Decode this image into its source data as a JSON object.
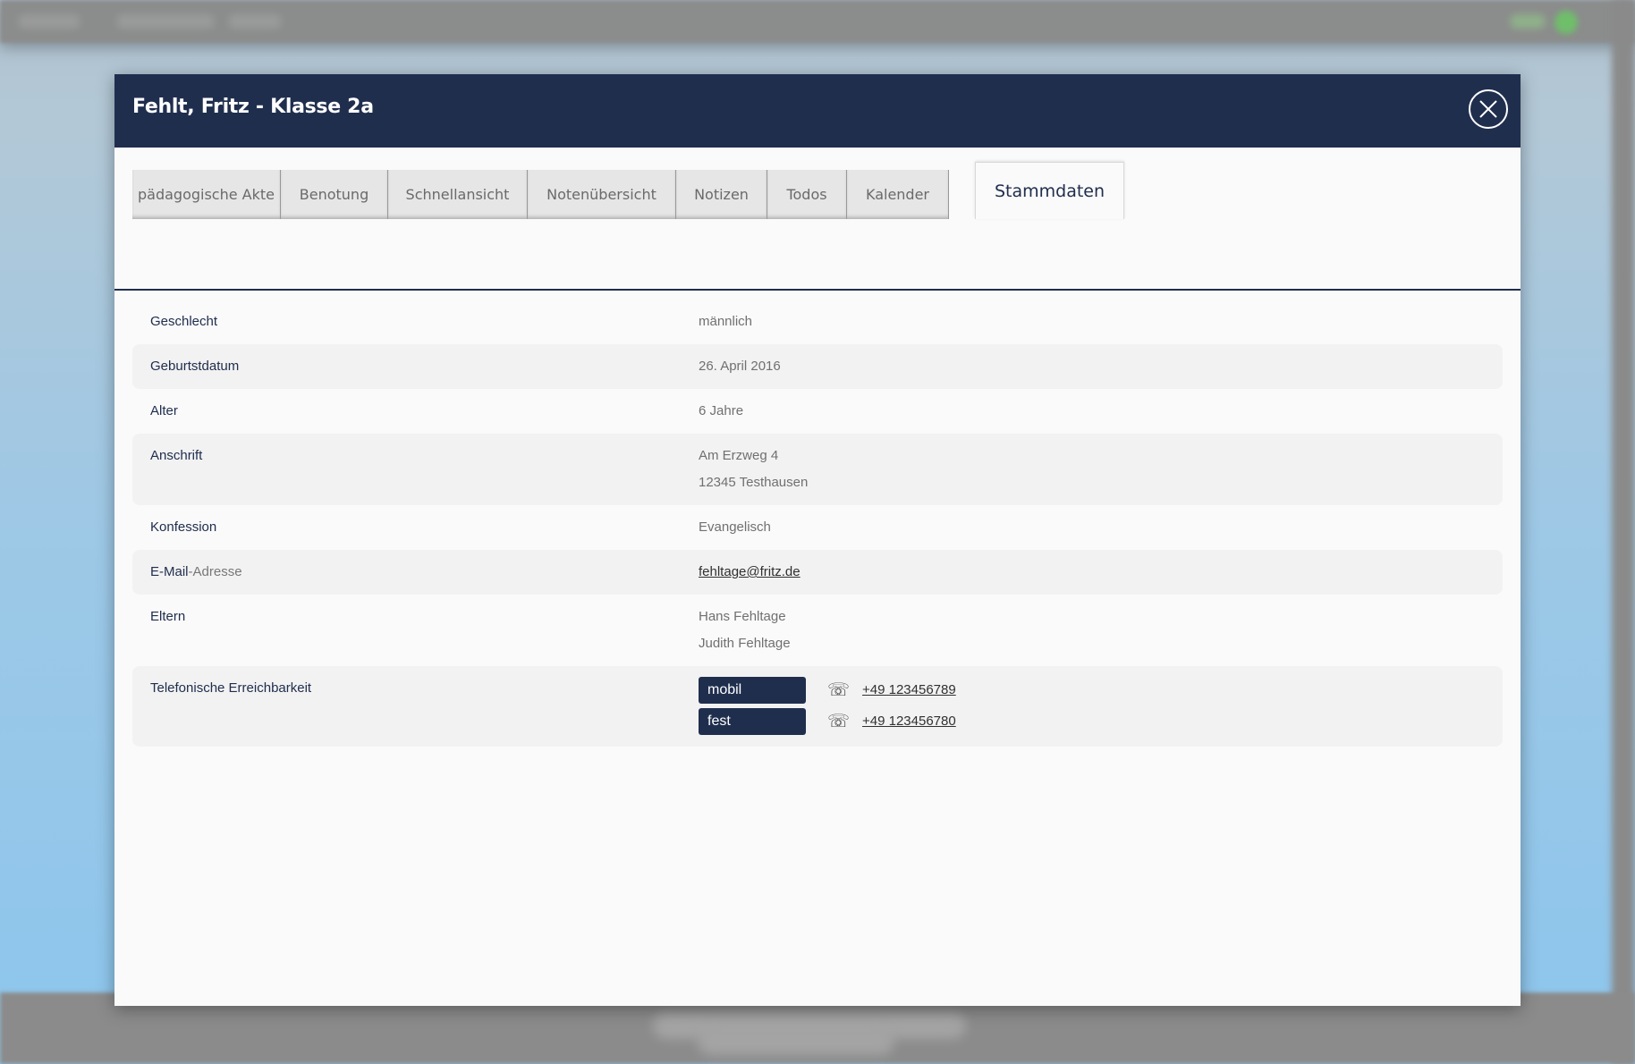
{
  "modal": {
    "title": "Fehlt, Fritz - Klasse 2a"
  },
  "tabs": [
    {
      "label": "pädagogische Akte",
      "active": false
    },
    {
      "label": "Benotung",
      "active": false
    },
    {
      "label": "Schnellansicht",
      "active": false
    },
    {
      "label": "Notenübersicht",
      "active": false
    },
    {
      "label": "Notizen",
      "active": false
    },
    {
      "label": "Todos",
      "active": false
    },
    {
      "label": "Kalender",
      "active": false
    },
    {
      "label": "Stammdaten",
      "active": true
    }
  ],
  "stammdaten": {
    "geschlecht": {
      "label": "Geschlecht",
      "value": "männlich"
    },
    "geburtsdatum": {
      "label": "Geburtstdatum",
      "value": "26. April 2016"
    },
    "alter": {
      "label": "Alter",
      "value": "6 Jahre"
    },
    "anschrift": {
      "label": "Anschrift",
      "street": "Am Erzweg 4",
      "city": "12345 Testhausen"
    },
    "konfession": {
      "label": "Konfession",
      "value": "Evangelisch"
    },
    "email": {
      "label_main": "E-Mail",
      "label_suffix": "-Adresse",
      "value": "fehltage@fritz.de"
    },
    "eltern": {
      "label": "Eltern",
      "parent1": "Hans Fehltage",
      "parent2": "Judith Fehltage"
    },
    "telefon": {
      "label": "Telefonische Erreichbarkeit",
      "entries": [
        {
          "type": "mobil",
          "number": "+49 123456789",
          "icon": "phone-icon"
        },
        {
          "type": "fest",
          "number": "+49 123456780",
          "icon": "phone-icon"
        }
      ]
    }
  },
  "colors": {
    "header_bg": "#202e4e",
    "badge_bg": "#202e4e",
    "row_alt_bg": "#f2f2f2"
  }
}
